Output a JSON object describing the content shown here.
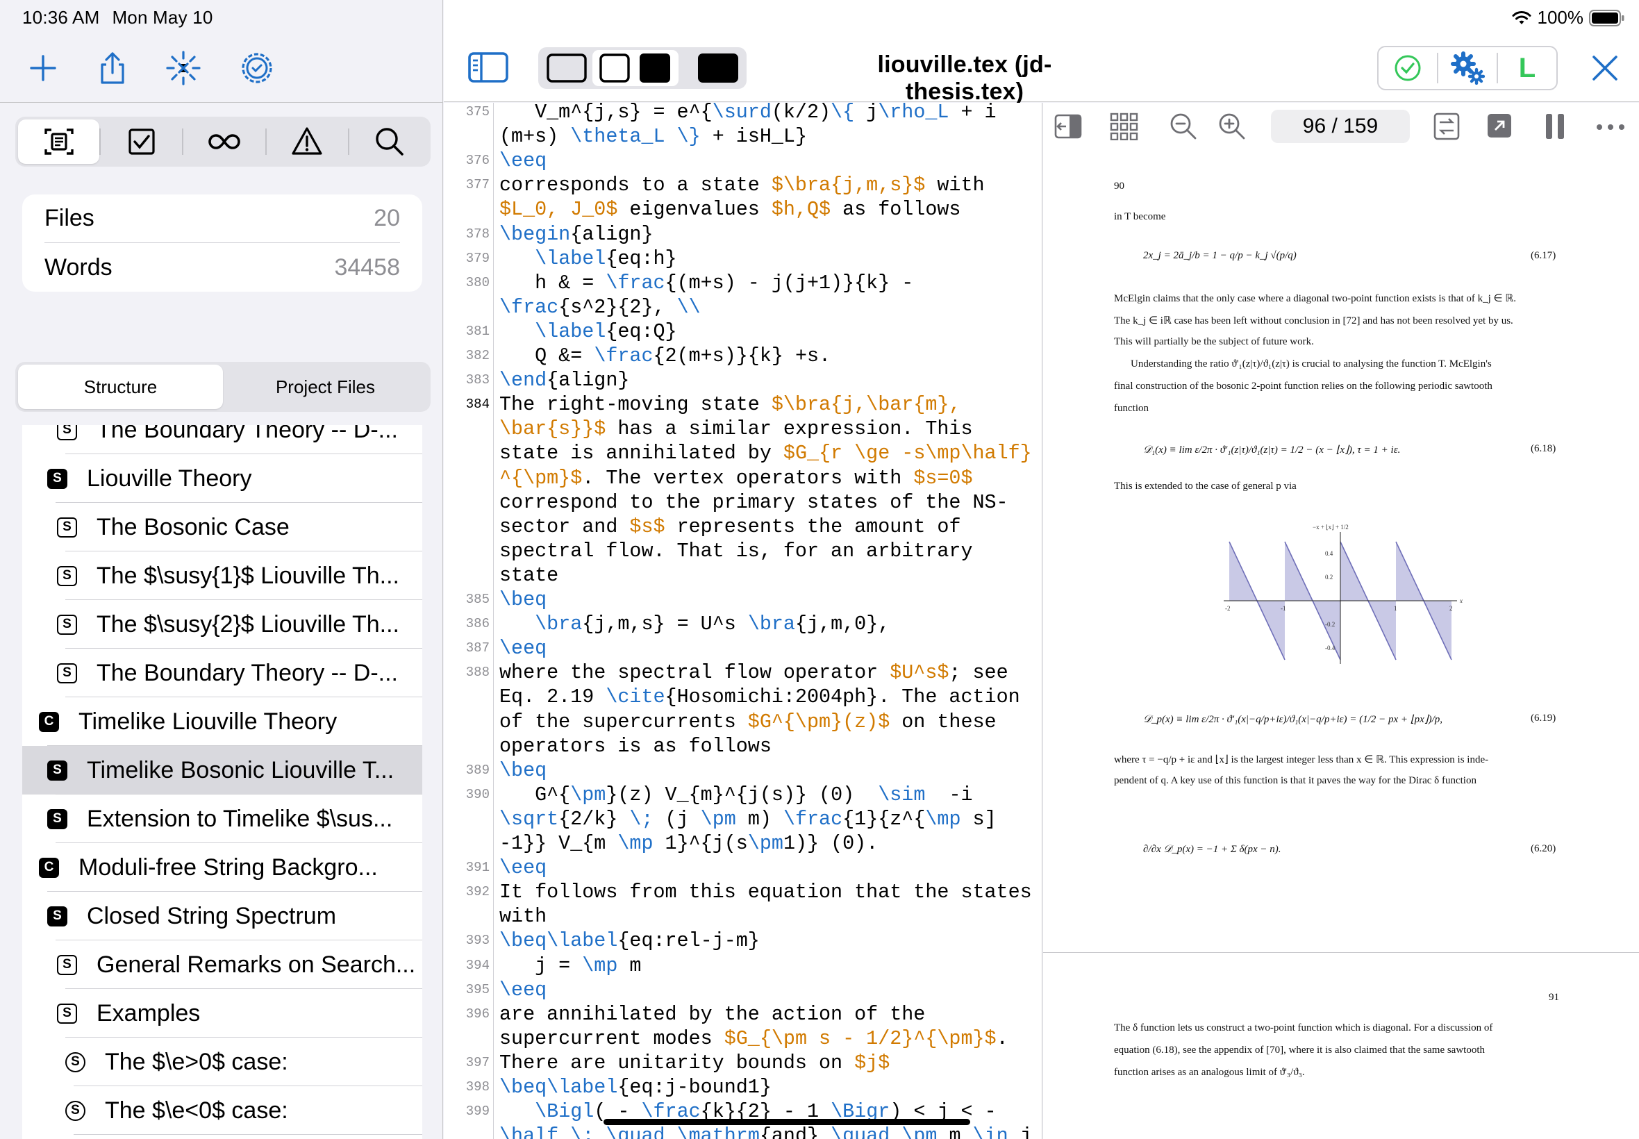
{
  "status": {
    "time": "10:36 AM",
    "date": "Mon May 10",
    "battery": "100%"
  },
  "sidebar": {
    "toolbar_icons": [
      "plus-icon",
      "share-icon",
      "spark-icon",
      "gear-badge-icon"
    ],
    "filters": [
      "document-scan-icon",
      "checkbox-icon",
      "infinity-icon",
      "warning-icon",
      "search-icon"
    ],
    "stats": [
      {
        "label": "Files",
        "value": "20"
      },
      {
        "label": "Words",
        "value": "34458"
      }
    ],
    "tabs": [
      "Structure",
      "Project Files"
    ],
    "tree": [
      {
        "type": "S",
        "style": "outline",
        "label": "The Boundary Theory -- D-..."
      },
      {
        "type": "S",
        "style": "fill",
        "label": "Liouville Theory"
      },
      {
        "type": "S",
        "style": "outline",
        "label": "The Bosonic Case"
      },
      {
        "type": "S",
        "style": "outline",
        "label": "The $\\susy{1}$ Liouville Th..."
      },
      {
        "type": "S",
        "style": "outline",
        "label": "The $\\susy{2}$ Liouville Th..."
      },
      {
        "type": "S",
        "style": "outline",
        "label": "The Boundary Theory -- D-..."
      },
      {
        "type": "C",
        "style": "fill",
        "label": "Timelike Liouville Theory"
      },
      {
        "type": "S",
        "style": "fill",
        "label": "Timelike Bosonic Liouville T...",
        "selected": true
      },
      {
        "type": "S",
        "style": "fill",
        "label": "Extension to Timelike $\\sus..."
      },
      {
        "type": "C",
        "style": "fill",
        "label": "Moduli-free String Backgro..."
      },
      {
        "type": "S",
        "style": "fill",
        "label": "Closed String Spectrum"
      },
      {
        "type": "S",
        "style": "outline",
        "label": "General Remarks on Search..."
      },
      {
        "type": "S",
        "style": "outline",
        "label": "Examples"
      },
      {
        "type": "S",
        "style": "circle",
        "label": "The $\\e>0$ case:"
      },
      {
        "type": "S",
        "style": "circle",
        "label": "The $\\e<0$ case:"
      }
    ]
  },
  "toolbar": {
    "title": "liouville.tex (jd-thesis.tex)",
    "typeset_status": "ok",
    "engine_label": "L"
  },
  "editor": {
    "lines": [
      {
        "n": "375",
        "t": "   V_m^{j,s} = e^{[K:\\surd](k/2)[K:\\{] j[K:\\rho_L] + i"
      },
      {
        "n": "",
        "t": "(m+s) [K:\\theta_L] [K:\\}] + isH_L}"
      },
      {
        "n": "376",
        "t": "[K:\\eeq]"
      },
      {
        "n": "377",
        "t": "corresponds to a state [M:$\\bra{j,m,s}$] with"
      },
      {
        "n": "",
        "t": "[M:$L_0, J_0$] eigenvalues [M:$h,Q$] as follows"
      },
      {
        "n": "378",
        "t": "[K:\\begin]{align}"
      },
      {
        "n": "379",
        "t": "   [K:\\label]{eq:h}"
      },
      {
        "n": "380",
        "t": "   h & = [K:\\frac]{(m+s) - j(j+1)}{k} -"
      },
      {
        "n": "",
        "t": "[K:\\frac]{s^2}{2}, [K:\\\\]"
      },
      {
        "n": "381",
        "t": "   [K:\\label]{eq:Q}"
      },
      {
        "n": "382",
        "t": "   Q &= [K:\\frac]{2(m+s)}{k} +s."
      },
      {
        "n": "383",
        "t": "[K:\\end]{align}"
      },
      {
        "n": "384",
        "t": "The right-moving state [M:$\\bra{j,\\bar{m},]",
        "cur": true
      },
      {
        "n": "",
        "t": "[M:\\bar{s}}$] has a similar expression. This"
      },
      {
        "n": "",
        "t": "state is annihilated by [M:$G_{r \\ge -s\\mp\\half}]"
      },
      {
        "n": "",
        "t": "[M:^{\\pm}$]. The vertex operators with [M:$s=0$]"
      },
      {
        "n": "",
        "t": "correspond to the primary states of the NS-"
      },
      {
        "n": "",
        "t": "sector and [M:$s$] represents the amount of"
      },
      {
        "n": "",
        "t": "spectral flow. That is, for an arbitrary"
      },
      {
        "n": "",
        "t": "state"
      },
      {
        "n": "385",
        "t": "[K:\\beq]"
      },
      {
        "n": "386",
        "t": "   [K:\\bra]{j,m,s} = U^s [K:\\bra]{j,m,0},"
      },
      {
        "n": "387",
        "t": "[K:\\eeq]"
      },
      {
        "n": "388",
        "t": "where the spectral flow operator [M:$U^s$]; see"
      },
      {
        "n": "",
        "t": "Eq. 2.19 [K:\\cite]{Hosomichi:2004ph}. The action"
      },
      {
        "n": "",
        "t": "of the supercurrents [M:$G^{\\pm}(z)$] on these"
      },
      {
        "n": "",
        "t": "operators is as follows"
      },
      {
        "n": "389",
        "t": "[K:\\beq]"
      },
      {
        "n": "390",
        "t": "   G^{[K:\\pm]}(z) V_{m}^{j(s)} (0)  [K:\\sim]  -i"
      },
      {
        "n": "",
        "t": "[K:\\sqrt]{2/k} [K:\\;] (j [K:\\pm] m) [K:\\frac]{1}{z^{[K:\\mp] s]"
      },
      {
        "n": "",
        "t": "-1}} V_{m [K:\\mp] 1}^{j(s[K:\\pm]1)} (0)."
      },
      {
        "n": "391",
        "t": "[K:\\eeq]"
      },
      {
        "n": "392",
        "t": "It follows from this equation that the states"
      },
      {
        "n": "",
        "t": "with"
      },
      {
        "n": "393",
        "t": "[K:\\beq\\label]{eq:rel-j-m}"
      },
      {
        "n": "394",
        "t": "   j = [K:\\mp] m"
      },
      {
        "n": "395",
        "t": "[K:\\eeq]"
      },
      {
        "n": "396",
        "t": "are annihilated by the action of the"
      },
      {
        "n": "",
        "t": "supercurrent modes [M:$G_{\\pm s - 1/2}^{\\pm}$]."
      },
      {
        "n": "397",
        "t": "There are unitarity bounds on [M:$j$]"
      },
      {
        "n": "398",
        "t": "[K:\\beq\\label]{eq:j-bound1}"
      },
      {
        "n": "399",
        "t": "   [K:\\Bigl]( - [K:\\frac]{k}{2} - 1 [K:\\Bigr]) < j < -"
      },
      {
        "n": "",
        "t": "[K:\\half] [K:\\;] [K:\\quad] [K:\\mathrm]{and} [K:\\quad] [K:\\pm] m [K:\\in] j"
      }
    ]
  },
  "pdf": {
    "page_indicator": "96 / 159",
    "page1": {
      "number": "90",
      "become": "in T become",
      "eq617": "2x_j = 2ā_j/b = 1 − q/p − k_j √(p/q)",
      "eq617_tag": "(6.17)",
      "p1": [
        "McElgin claims that the only case where a diagonal two-point function exists is that of k_j ∈ ℝ.",
        "The k_j ∈ iℝ case has been left without conclusion in [72] and has not been resolved yet by us.",
        "This will partially be the subject of future work."
      ],
      "p2": [
        "Understanding the ratio ϑ'₁(z|τ)/ϑ₁(z|τ) is crucial to analysing the function T.  McElgin's",
        "final construction of the bosonic 2-point function relies on the following periodic sawtooth",
        "function"
      ],
      "eq618": "𝒟₁(x) ≡ lim ε/2π · ϑ'₁(z|τ)/ϑ₁(z|τ) = 1/2 − (x − ⌊x⌋),       τ = 1 + iε.",
      "eq618_tag": "(6.18)",
      "extended": "This is extended to the case of general p via",
      "plot_label": "−x + ⌊x⌋ + 1/2",
      "eq619": "𝒟_p(x) ≡ lim ε/2π · ϑ'₁(x|−q/p+iε)/ϑ₁(x|−q/p+iε) = (1/2 − px + ⌊px⌋)/p,",
      "eq619_tag": "(6.19)",
      "p3": [
        "where τ = −q/p + iε and ⌊x⌋ is the largest integer less than x ∈ ℝ.  This expression is inde-",
        "pendent of q.  A key use of this function is that it paves the way for the Dirac δ function"
      ],
      "eq620": "∂/∂x 𝒟_p(x) = −1 + Σ δ(px − n).",
      "eq620_tag": "(6.20)"
    },
    "page2": {
      "number": "91",
      "p1": [
        "The δ function lets us construct a two-point function which is diagonal.  For a discussion of",
        "equation (6.18), see the appendix of [70], where it is also claimed that the same sawtooth",
        "function arises as an analogous limit of ϑ'₃/ϑ₃."
      ]
    }
  },
  "colors": {
    "accent": "#1f6fc7",
    "latex_math": "#d17a00",
    "green": "#34c759",
    "plot_fill": "#c9c9e6",
    "plot_line": "#6f6fb8"
  },
  "chart_data": {
    "type": "area",
    "x_ticks": [
      "-2",
      "-1",
      "1",
      "2"
    ],
    "y_ticks": [
      "0.4",
      "0.2",
      "-0.2",
      "-0.4"
    ],
    "xlim": [
      -2,
      2
    ],
    "ylim": [
      -0.5,
      0.5
    ],
    "function": "-x + floor(x) + 1/2",
    "axis_x_label": "x"
  }
}
